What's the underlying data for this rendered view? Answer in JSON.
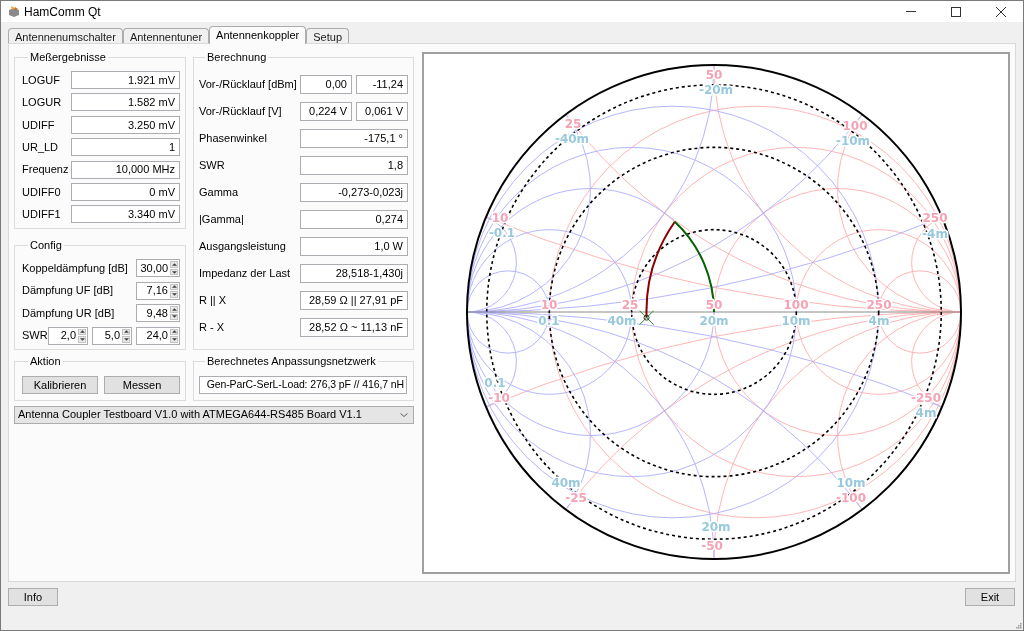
{
  "window": {
    "title": "HamComm Qt"
  },
  "tabs": [
    {
      "label": "Antennenumschalter",
      "selected": false
    },
    {
      "label": "Antennentuner",
      "selected": false
    },
    {
      "label": "Antennenkoppler",
      "selected": true
    },
    {
      "label": "Setup",
      "selected": false
    }
  ],
  "measurements": {
    "title": "Meßergebnisse",
    "rows": [
      {
        "label": "LOGUF",
        "value": "1.921 mV"
      },
      {
        "label": "LOGUR",
        "value": "1.582 mV"
      },
      {
        "label": "UDIFF",
        "value": "3.250 mV"
      },
      {
        "label": "UR_LD",
        "value": "1"
      },
      {
        "label": "Frequenz",
        "value": "10,000 MHz"
      },
      {
        "label": "UDIFF0",
        "value": "0 mV"
      },
      {
        "label": "UDIFF1",
        "value": "3.340 mV"
      }
    ]
  },
  "calculation": {
    "title": "Berechnung",
    "rows": [
      {
        "label": "Vor-/Rücklauf [dBm]",
        "values": [
          "0,00",
          "-11,24"
        ]
      },
      {
        "label": "Vor-/Rücklauf [V]",
        "values": [
          "0,224 V",
          "0,061 V"
        ]
      },
      {
        "label": "Phasenwinkel",
        "values": [
          "-175,1 °"
        ]
      },
      {
        "label": "SWR",
        "values": [
          "1,8"
        ]
      },
      {
        "label": "Gamma",
        "values": [
          "-0,273-0,023j"
        ]
      },
      {
        "label": "|Gamma|",
        "values": [
          "0,274"
        ]
      },
      {
        "label": "Ausgangsleistung",
        "values": [
          "1,0 W"
        ]
      },
      {
        "label": "Impedanz der Last",
        "values": [
          "28,518-1,430j"
        ]
      },
      {
        "label": "R || X",
        "values": [
          "28,59 Ω || 27,91 pF"
        ]
      },
      {
        "label": "R - X",
        "values": [
          "28,52 Ω ~ 11,13 nF"
        ]
      }
    ]
  },
  "config": {
    "title": "Config",
    "rows": [
      {
        "label": "Koppeldämpfung [dB]",
        "values": [
          "30,00"
        ]
      },
      {
        "label": "Dämpfung UF [dB]",
        "values": [
          "7,16"
        ]
      },
      {
        "label": "Dämpfung UR [dB]",
        "values": [
          "9,48"
        ]
      },
      {
        "label": "SWR",
        "values": [
          "2,0",
          "5,0",
          "24,0"
        ]
      }
    ]
  },
  "action": {
    "title": "Aktion",
    "buttons": [
      "Kalibrieren",
      "Messen"
    ]
  },
  "matching_network": {
    "title": "Berechnetes Anpassungsnetzwerk",
    "value": "Gen-ParC-SerL-Load: 276,3 pF // 416,7 nH"
  },
  "board_select": {
    "value": "Antenna Coupler Testboard V1.0 with ATMEGA644-RS485 Board V1.1"
  },
  "smith_chart": {
    "resistance_labels": [
      "10",
      "25",
      "50",
      "100",
      "250"
    ],
    "conductance_labels": [
      "0.1",
      "40m",
      "20m",
      "10m",
      "4m"
    ],
    "reactance_labels": [
      "50",
      "25",
      "100",
      "10",
      "250",
      "-10",
      "-250",
      "-25",
      "-100",
      "-50"
    ],
    "susceptance_labels": [
      "-20m",
      "-40m",
      "-10m",
      "-0.1",
      "-4m",
      "0.1",
      "4m",
      "40m",
      "10m",
      "20m"
    ]
  },
  "footer_buttons": [
    "Info",
    "Exit"
  ]
}
